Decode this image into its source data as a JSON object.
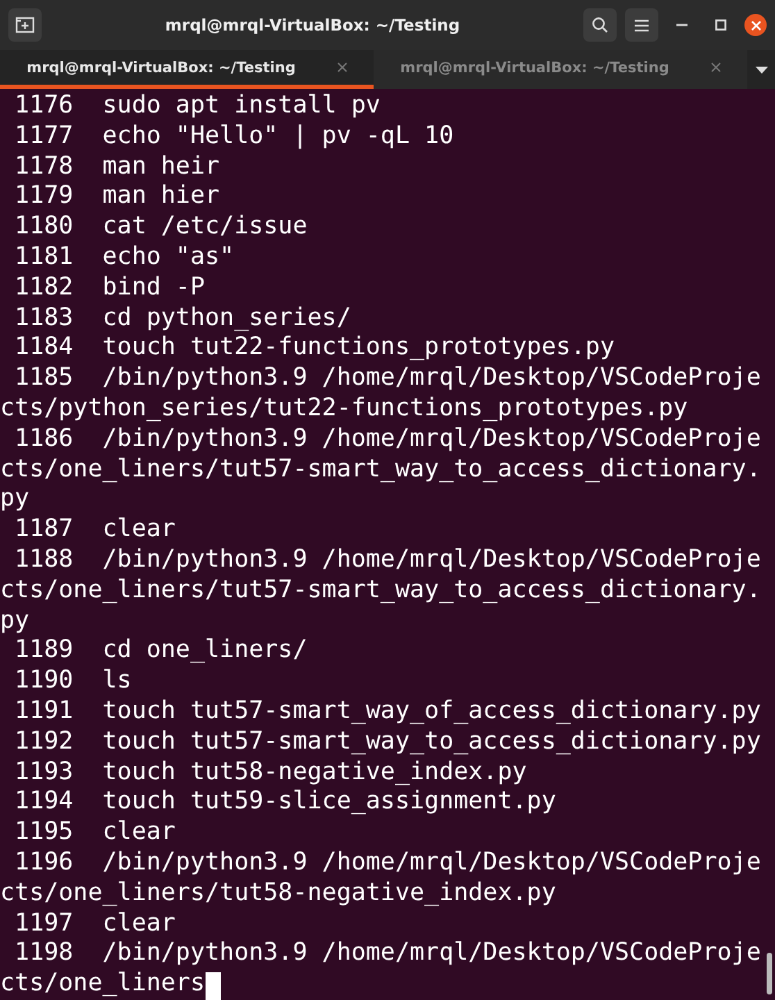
{
  "window": {
    "title": "mrql@mrql-VirtualBox: ~/Testing"
  },
  "tabs": [
    {
      "label": "mrql@mrql-VirtualBox: ~/Testing",
      "selected": true
    },
    {
      "label": "mrql@mrql-VirtualBox: ~/Testing",
      "selected": false
    }
  ],
  "terminal": {
    "lines": [
      " 1176  sudo apt install pv",
      " 1177  echo \"Hello\" | pv -qL 10",
      " 1178  man heir",
      " 1179  man hier",
      " 1180  cat /etc/issue",
      " 1181  echo \"as\"",
      " 1182  bind -P",
      " 1183  cd python_series/",
      " 1184  touch tut22-functions_prototypes.py",
      " 1185  /bin/python3.9 /home/mrql/Desktop/VSCodeProje",
      "cts/python_series/tut22-functions_prototypes.py",
      " 1186  /bin/python3.9 /home/mrql/Desktop/VSCodeProje",
      "cts/one_liners/tut57-smart_way_to_access_dictionary.",
      "py",
      " 1187  clear",
      " 1188  /bin/python3.9 /home/mrql/Desktop/VSCodeProje",
      "cts/one_liners/tut57-smart_way_to_access_dictionary.",
      "py",
      " 1189  cd one_liners/",
      " 1190  ls",
      " 1191  touch tut57-smart_way_of_access_dictionary.py",
      " 1192  touch tut57-smart_way_to_access_dictionary.py",
      " 1193  touch tut58-negative_index.py",
      " 1194  touch tut59-slice_assignment.py",
      " 1195  clear",
      " 1196  /bin/python3.9 /home/mrql/Desktop/VSCodeProje",
      "cts/one_liners/tut58-negative_index.py",
      " 1197  clear",
      " 1198  /bin/python3.9 /home/mrql/Desktop/VSCodeProje",
      "cts/one_liners"
    ]
  }
}
